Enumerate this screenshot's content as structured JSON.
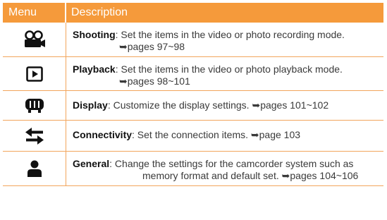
{
  "header": {
    "menu": "Menu",
    "description": "Description"
  },
  "rows": [
    {
      "icon": "camcorder-icon",
      "title": "Shooting",
      "text": ": Set the items in the video or photo recording mode.",
      "ref": "➥pages 97~98"
    },
    {
      "icon": "playback-icon",
      "title": "Playback",
      "text": ": Set the items in the video or photo playback mode.",
      "ref": "➥pages 98~101"
    },
    {
      "icon": "display-icon",
      "title": "Display",
      "text": ": Customize the display settings.",
      "ref": "➥pages 101~102"
    },
    {
      "icon": "connectivity-icon",
      "title": "Connectivity",
      "text": ": Set the connection items.",
      "ref": "➥page 103"
    },
    {
      "icon": "general-icon",
      "title": "General",
      "text": ": Change the settings for the camcorder system such as",
      "text2": "memory format and default set.",
      "ref": "➥pages 104~106"
    }
  ]
}
